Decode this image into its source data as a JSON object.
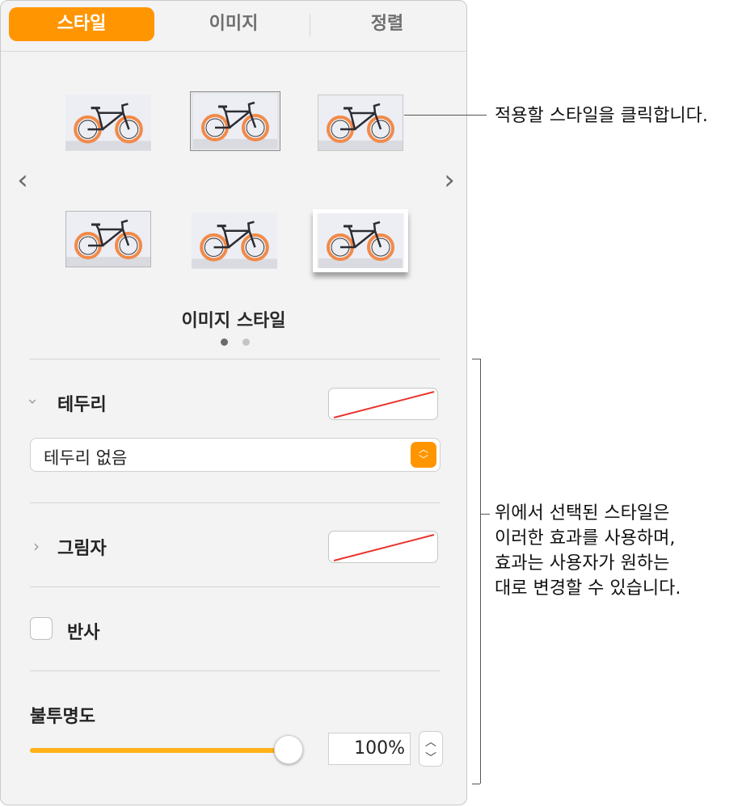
{
  "tabs": [
    {
      "label": "스타일",
      "active": true
    },
    {
      "label": "이미지",
      "active": false
    },
    {
      "label": "정렬",
      "active": false
    }
  ],
  "colors": {
    "accent": "#ff9500",
    "slider": "#ffb118",
    "no_border_line": "#e8342c"
  },
  "style_gallery": {
    "prev_icon": "chevron-left-icon",
    "next_icon": "chevron-right-icon",
    "title": "이미지 스타일",
    "page_count": 2,
    "current_page": 1,
    "selected_index": 1
  },
  "border": {
    "label": "테두리",
    "expanded": true,
    "popup_value": "테두리 없음"
  },
  "shadow": {
    "label": "그림자",
    "expanded": false
  },
  "reflection": {
    "label": "반사",
    "checked": false
  },
  "opacity": {
    "label": "불투명도",
    "value_text": "100%",
    "value": 100
  },
  "callouts": {
    "top": "적용할 스타일을 클릭합니다.",
    "side_lines": [
      "위에서 선택된 스타일은",
      "이러한 효과를 사용하며,",
      "효과는 사용자가 원하는",
      "대로 변경할 수 있습니다."
    ]
  }
}
